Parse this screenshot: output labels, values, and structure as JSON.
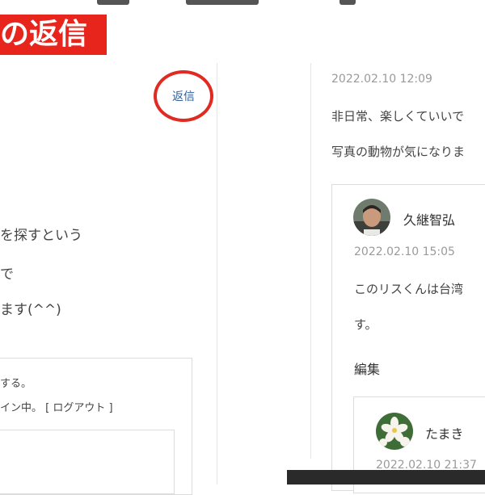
{
  "header": {
    "title": "の返信",
    "banner_color": "#e8251c"
  },
  "left_comment": {
    "reply_label": "返信",
    "reply_circle_color": "#e02a22",
    "lines": [
      "を探すという",
      "で",
      "ます(^^)"
    ]
  },
  "reply_form": {
    "note": "する。",
    "login_text": "イン中。",
    "logout_label": "[ ログアウト ]"
  },
  "right_comment": {
    "timestamp": "2022.02.10 12:09",
    "lines": [
      "非日常、楽しくていいで",
      "写真の動物が気になりま"
    ],
    "reply": {
      "author": "久継智弘",
      "avatar_icon": "person-photo-icon",
      "timestamp": "2022.02.10 15:05",
      "lines": [
        "このリスくんは台湾",
        "す。"
      ],
      "edit_label": "編集",
      "nested": {
        "author": "たまき",
        "avatar_icon": "flower-photo-icon",
        "timestamp": "2022.02.10 21:37"
      }
    }
  },
  "link_color": "#2f5d9a"
}
